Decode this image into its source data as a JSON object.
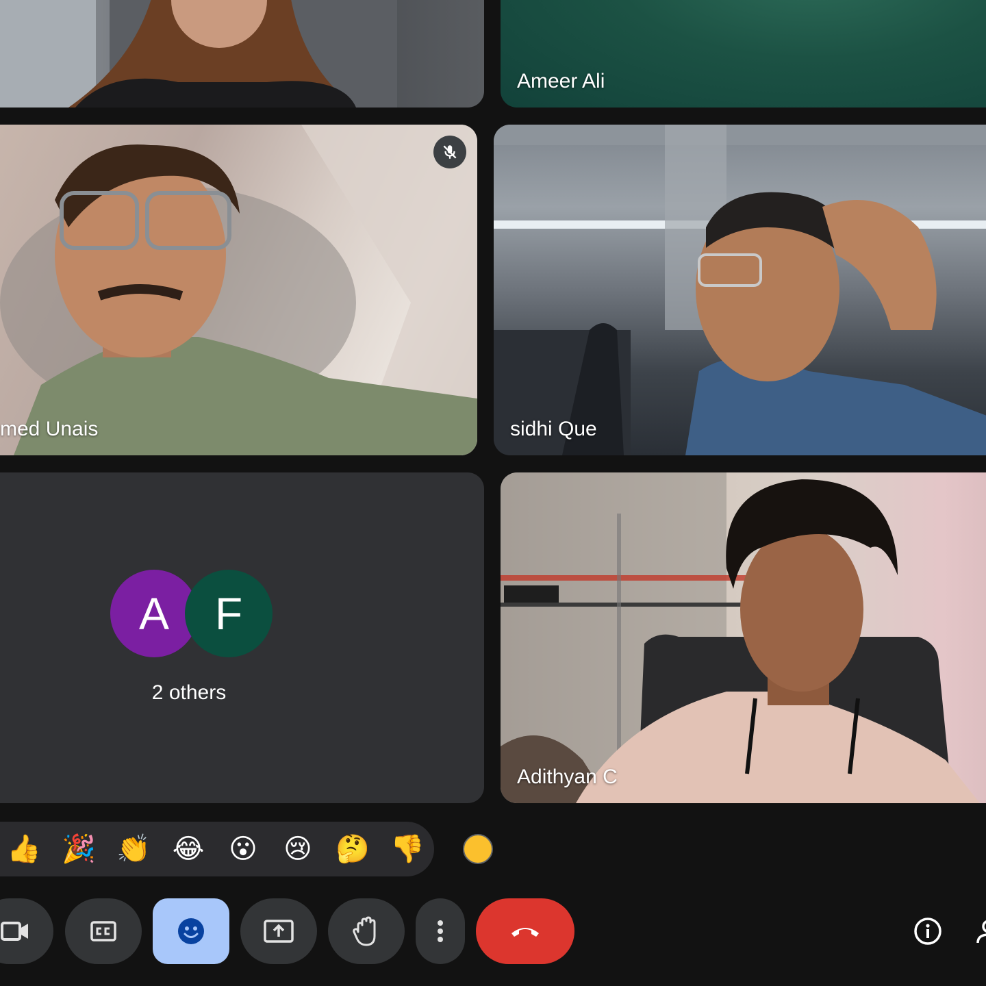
{
  "participants": [
    {
      "name": ""
    },
    {
      "name": "Ameer Ali"
    },
    {
      "name": "med Unais"
    },
    {
      "name": "sidhi Que"
    },
    {
      "name": "Adithyan C"
    }
  ],
  "others_tile": {
    "avatars": [
      {
        "letter": "A",
        "color": "#7b1fa2"
      },
      {
        "letter": "F",
        "color": "#0b4f3f"
      }
    ],
    "label": "2 others"
  },
  "reactions": {
    "emojis": [
      "👍",
      "🎉",
      "👏",
      "😂",
      "😮",
      "😢",
      "🤔",
      "👎"
    ],
    "skin_tone_color": "#fbc02d"
  },
  "controls": {
    "camera": "camera-icon",
    "captions": "closed-captions-icon",
    "reactions": "emoji-icon",
    "present": "present-screen-icon",
    "raise_hand": "raise-hand-icon",
    "more": "more-options-icon",
    "end_call": "end-call-icon",
    "info": "info-icon",
    "people": "people-icon"
  },
  "colors": {
    "background": "#121212",
    "tile": "#303134",
    "control": "#333537",
    "active_control": "#a8c7fa",
    "end_call": "#dc362e"
  }
}
